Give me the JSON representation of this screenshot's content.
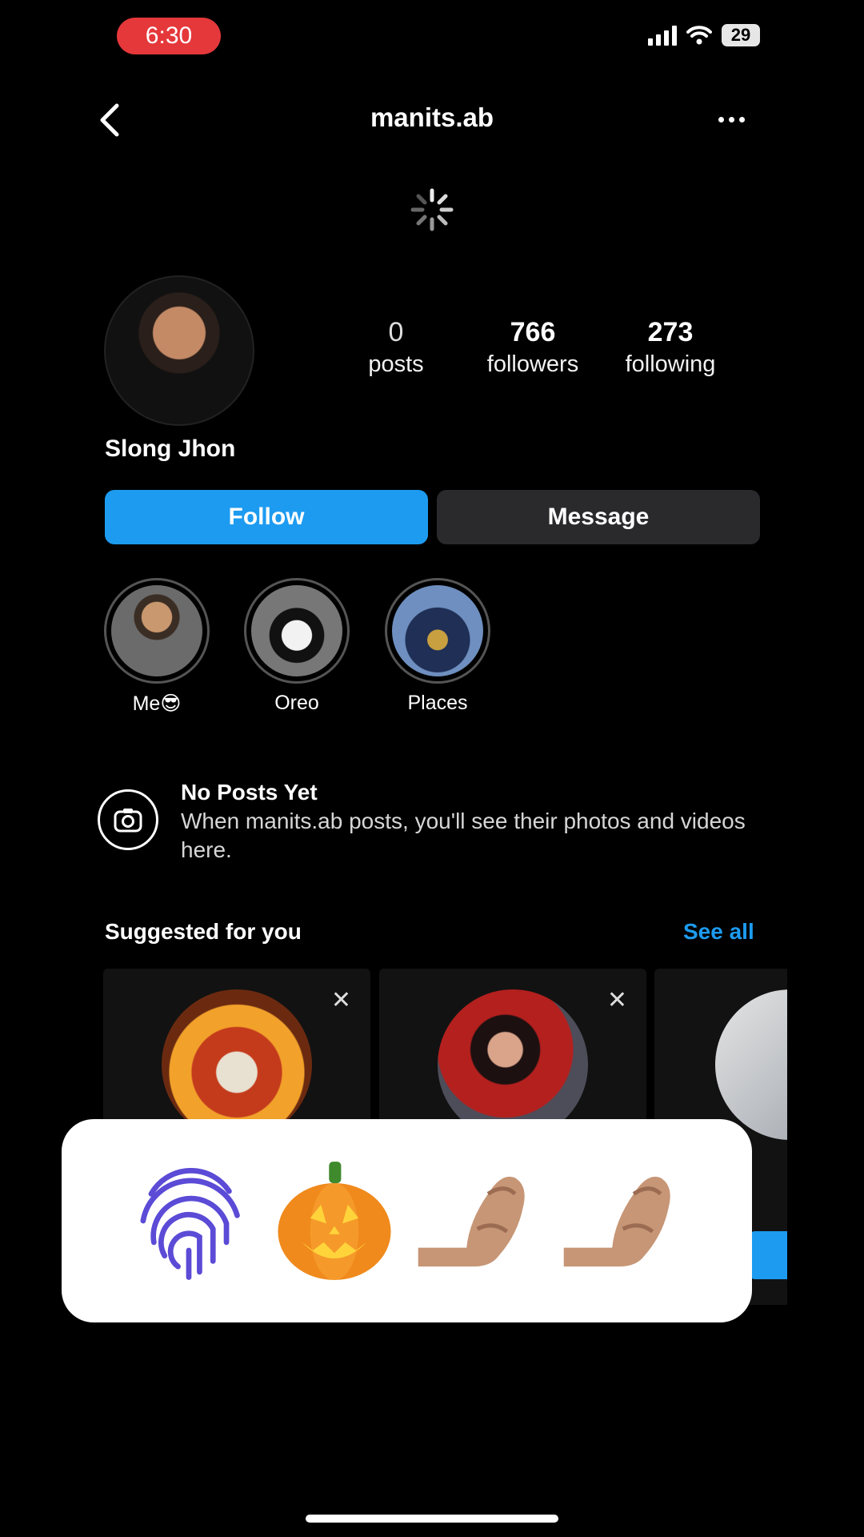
{
  "status_bar": {
    "time": "6:30",
    "battery": "29"
  },
  "header": {
    "username": "manits.ab"
  },
  "profile": {
    "name": "Slong Jhon",
    "stats": [
      {
        "value": "0",
        "label": "posts"
      },
      {
        "value": "766",
        "label": "followers"
      },
      {
        "value": "273",
        "label": "following"
      }
    ]
  },
  "actions": {
    "follow": "Follow",
    "message": "Message"
  },
  "highlights": [
    {
      "label": "Me😎"
    },
    {
      "label": "Oreo"
    },
    {
      "label": "Places"
    }
  ],
  "no_posts": {
    "title": "No Posts Yet",
    "body": "When manits.ab posts, you'll see their photos and videos here."
  },
  "suggested": {
    "title": "Suggested for you",
    "see_all": "See all"
  },
  "overlay": {
    "emojis": [
      "fingerprint-icon",
      "jack-o-lantern-emoji",
      "pinched-fingers-emoji",
      "pinched-fingers-emoji"
    ]
  },
  "colors": {
    "accent": "#1d9bf0",
    "background": "#000000",
    "button_dark": "#2a2a2d",
    "time_pill": "#e5383b"
  }
}
